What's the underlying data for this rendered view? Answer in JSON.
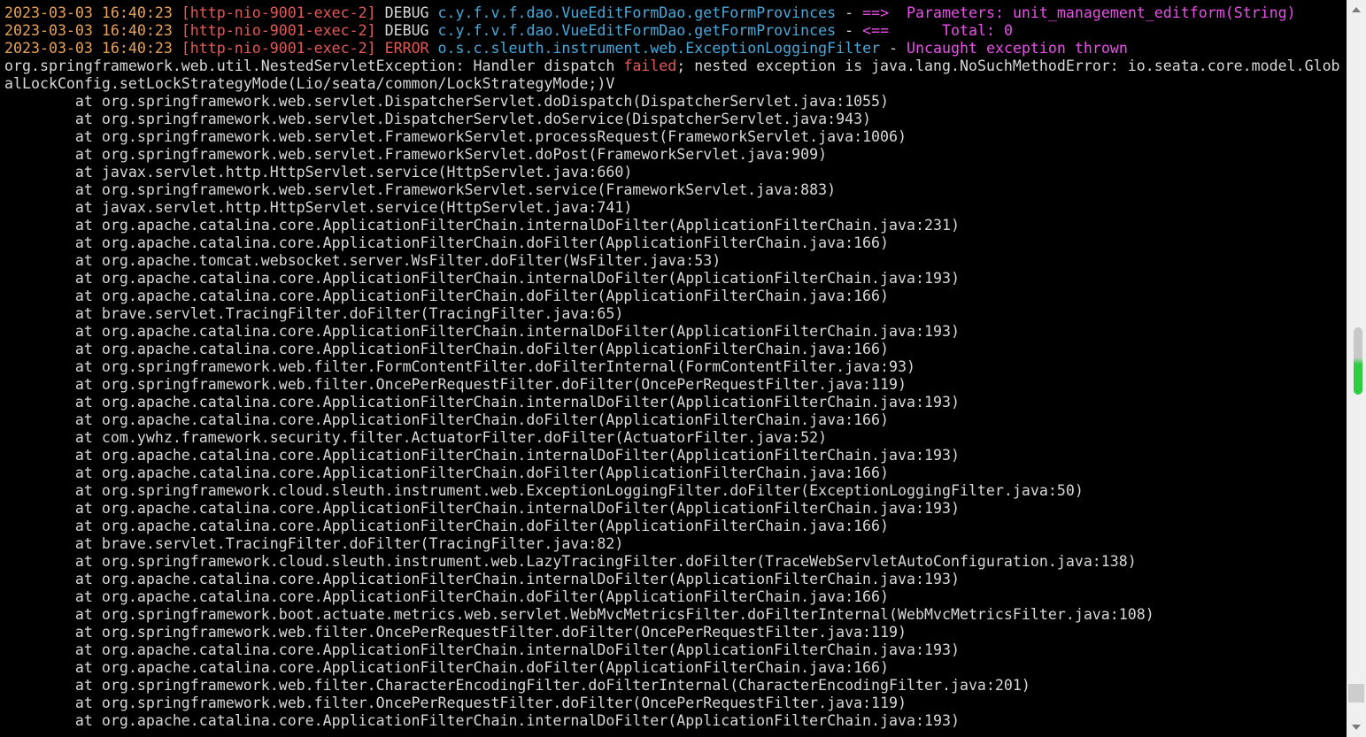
{
  "terminal": {
    "header_lines": [
      [
        {
          "text": "2023-03-03 16:40:23 ",
          "color": "#e8a35a"
        },
        {
          "text": "[http-nio-9001-exec-2] ",
          "color": "#e05a5a"
        },
        {
          "text": "DEBUG ",
          "color": "#d8d8d8"
        },
        {
          "text": "c.y.f.v.f.dao.VueEditFormDao.getFormProvinces",
          "color": "#4aa8d8"
        },
        {
          "text": " - ",
          "color": "#d8d8d8"
        },
        {
          "text": "==>  Parameters: unit_management_editform(String)",
          "color": "#ea4fea"
        }
      ],
      [
        {
          "text": "2023-03-03 16:40:23 ",
          "color": "#e8a35a"
        },
        {
          "text": "[http-nio-9001-exec-2] ",
          "color": "#e05a5a"
        },
        {
          "text": "DEBUG ",
          "color": "#d8d8d8"
        },
        {
          "text": "c.y.f.v.f.dao.VueEditFormDao.getFormProvinces",
          "color": "#4aa8d8"
        },
        {
          "text": " - ",
          "color": "#d8d8d8"
        },
        {
          "text": "<==      Total: 0",
          "color": "#ea4fea"
        }
      ],
      [
        {
          "text": "2023-03-03 16:40:23 ",
          "color": "#e8a35a"
        },
        {
          "text": "[http-nio-9001-exec-2] ",
          "color": "#e05a5a"
        },
        {
          "text": "ERROR ",
          "color": "#e05a5a"
        },
        {
          "text": "o.s.c.sleuth.instrument.web.ExceptionLoggingFilter",
          "color": "#4aa8d8"
        },
        {
          "text": " - ",
          "color": "#d8d8d8"
        },
        {
          "text": "Uncaught exception thrown",
          "color": "#ea4fea"
        }
      ],
      [
        {
          "text": "org.springframework.web.util.NestedServletException: Handler dispatch ",
          "color": "#d8d8d8"
        },
        {
          "text": "failed",
          "color": "#e05a5a"
        },
        {
          "text": "; nested exception is java.lang.NoSuchMethodError: io.seata.core.model.Glob",
          "color": "#d8d8d8"
        }
      ],
      [
        {
          "text": "alLockConfig.setLockStrategyMode(Lio/seata/common/LockStrategyMode;)V",
          "color": "#d8d8d8"
        }
      ]
    ],
    "stack_frames": [
      "        at org.springframework.web.servlet.DispatcherServlet.doDispatch(DispatcherServlet.java:1055)",
      "        at org.springframework.web.servlet.DispatcherServlet.doService(DispatcherServlet.java:943)",
      "        at org.springframework.web.servlet.FrameworkServlet.processRequest(FrameworkServlet.java:1006)",
      "        at org.springframework.web.servlet.FrameworkServlet.doPost(FrameworkServlet.java:909)",
      "        at javax.servlet.http.HttpServlet.service(HttpServlet.java:660)",
      "        at org.springframework.web.servlet.FrameworkServlet.service(FrameworkServlet.java:883)",
      "        at javax.servlet.http.HttpServlet.service(HttpServlet.java:741)",
      "        at org.apache.catalina.core.ApplicationFilterChain.internalDoFilter(ApplicationFilterChain.java:231)",
      "        at org.apache.catalina.core.ApplicationFilterChain.doFilter(ApplicationFilterChain.java:166)",
      "        at org.apache.tomcat.websocket.server.WsFilter.doFilter(WsFilter.java:53)",
      "        at org.apache.catalina.core.ApplicationFilterChain.internalDoFilter(ApplicationFilterChain.java:193)",
      "        at org.apache.catalina.core.ApplicationFilterChain.doFilter(ApplicationFilterChain.java:166)",
      "        at brave.servlet.TracingFilter.doFilter(TracingFilter.java:65)",
      "        at org.apache.catalina.core.ApplicationFilterChain.internalDoFilter(ApplicationFilterChain.java:193)",
      "        at org.apache.catalina.core.ApplicationFilterChain.doFilter(ApplicationFilterChain.java:166)",
      "        at org.springframework.web.filter.FormContentFilter.doFilterInternal(FormContentFilter.java:93)",
      "        at org.springframework.web.filter.OncePerRequestFilter.doFilter(OncePerRequestFilter.java:119)",
      "        at org.apache.catalina.core.ApplicationFilterChain.internalDoFilter(ApplicationFilterChain.java:193)",
      "        at org.apache.catalina.core.ApplicationFilterChain.doFilter(ApplicationFilterChain.java:166)",
      "        at com.ywhz.framework.security.filter.ActuatorFilter.doFilter(ActuatorFilter.java:52)",
      "        at org.apache.catalina.core.ApplicationFilterChain.internalDoFilter(ApplicationFilterChain.java:193)",
      "        at org.apache.catalina.core.ApplicationFilterChain.doFilter(ApplicationFilterChain.java:166)",
      "        at org.springframework.cloud.sleuth.instrument.web.ExceptionLoggingFilter.doFilter(ExceptionLoggingFilter.java:50)",
      "        at org.apache.catalina.core.ApplicationFilterChain.internalDoFilter(ApplicationFilterChain.java:193)",
      "        at org.apache.catalina.core.ApplicationFilterChain.doFilter(ApplicationFilterChain.java:166)",
      "        at brave.servlet.TracingFilter.doFilter(TracingFilter.java:82)",
      "        at org.springframework.cloud.sleuth.instrument.web.LazyTracingFilter.doFilter(TraceWebServletAutoConfiguration.java:138)",
      "        at org.apache.catalina.core.ApplicationFilterChain.internalDoFilter(ApplicationFilterChain.java:193)",
      "        at org.apache.catalina.core.ApplicationFilterChain.doFilter(ApplicationFilterChain.java:166)",
      "        at org.springframework.boot.actuate.metrics.web.servlet.WebMvcMetricsFilter.doFilterInternal(WebMvcMetricsFilter.java:108)",
      "        at org.springframework.web.filter.OncePerRequestFilter.doFilter(OncePerRequestFilter.java:119)",
      "        at org.apache.catalina.core.ApplicationFilterChain.internalDoFilter(ApplicationFilterChain.java:193)",
      "        at org.apache.catalina.core.ApplicationFilterChain.doFilter(ApplicationFilterChain.java:166)",
      "        at org.springframework.web.filter.CharacterEncodingFilter.doFilterInternal(CharacterEncodingFilter.java:201)",
      "        at org.springframework.web.filter.OncePerRequestFilter.doFilter(OncePerRequestFilter.java:119)",
      "        at org.apache.catalina.core.ApplicationFilterChain.internalDoFilter(ApplicationFilterChain.java:193)"
    ],
    "stack_color": "#d8d8d8",
    "background": "#000000"
  },
  "scrollbar": {
    "up_icon": "arrow-up-icon",
    "down_icon": "arrow-down-icon",
    "indicator_color_top": "#c8c8c8",
    "indicator_color_bottom": "#2ecc40"
  }
}
